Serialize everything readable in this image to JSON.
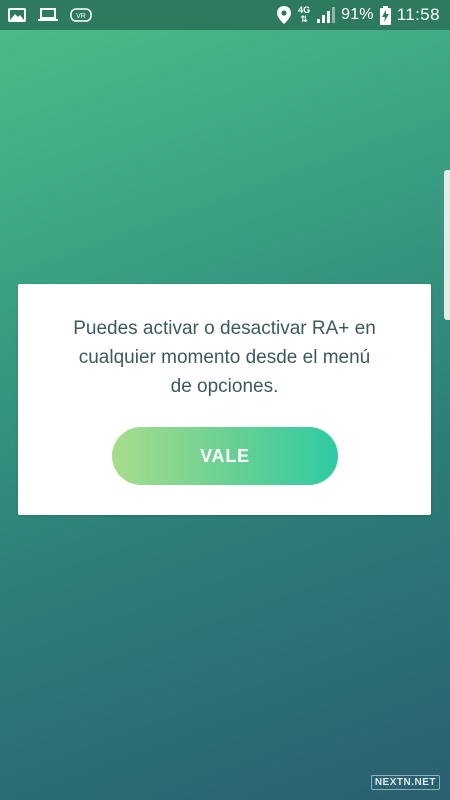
{
  "status_bar": {
    "icons_left": [
      "gallery-icon",
      "laptop-icon",
      "vr-icon"
    ],
    "vr_label": "VR",
    "network_type": "4G",
    "battery_percent": "91%",
    "time": "11:58"
  },
  "dialog": {
    "message": "Puedes activar o desactivar RA+ en\ncualquier momento desde el menú\nde opciones.",
    "button_label": "VALE"
  },
  "watermark": "NEXTN.NET",
  "colors": {
    "status_bar": "#2e7a5e",
    "background_top": "#4cbf87",
    "background_bottom": "#2a5f70",
    "dialog_text": "#3c5a5e",
    "button_gradient_start": "#a7dc8d",
    "button_gradient_end": "#2fcaa4"
  }
}
